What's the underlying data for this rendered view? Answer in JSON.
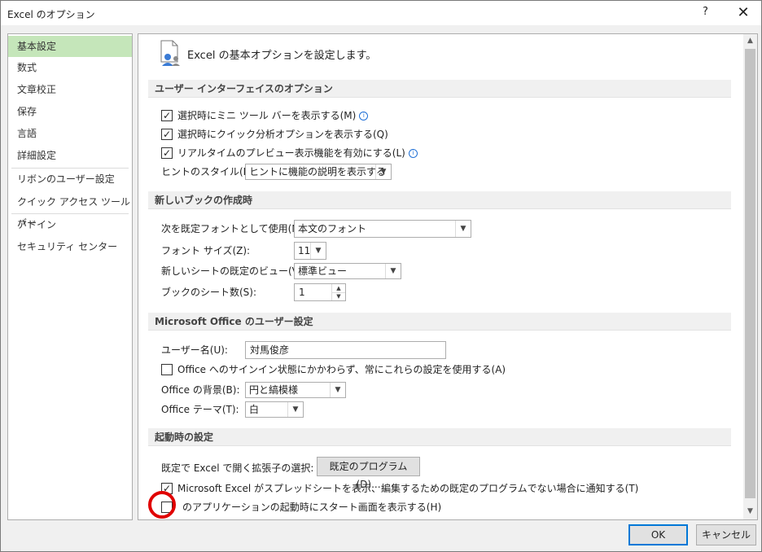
{
  "window": {
    "title": "Excel のオプション",
    "help_label": "?",
    "close_label": "✕"
  },
  "nav": {
    "items": [
      "基本設定",
      "数式",
      "文章校正",
      "保存",
      "言語",
      "詳細設定",
      "リボンのユーザー設定",
      "クイック アクセス ツール バー",
      "アドイン",
      "セキュリティ センター"
    ],
    "selected": "基本設定"
  },
  "header": {
    "text": "Excel の基本オプションを設定します。"
  },
  "ui_options": {
    "title": "ユーザー インターフェイスのオプション",
    "mini_toolbar": {
      "label": "選択時にミニ ツール バーを表示する(M)",
      "checked": true
    },
    "quick_analysis": {
      "label": "選択時にクイック分析オプションを表示する(Q)",
      "checked": true
    },
    "live_preview": {
      "label": "リアルタイムのプレビュー表示機能を有効にする(L)",
      "checked": true
    },
    "screentip_label": "ヒントのスタイル(R):",
    "screentip_value": "ヒントに機能の説明を表示する"
  },
  "new_workbook": {
    "title": "新しいブックの作成時",
    "font_label": "次を既定フォントとして使用(N):",
    "font_value": "本文のフォント",
    "size_label": "フォント サイズ(Z):",
    "size_value": "11",
    "view_label": "新しいシートの既定のビュー(V):",
    "view_value": "標準ビュー",
    "sheets_label": "ブックのシート数(S):",
    "sheets_value": "1"
  },
  "user_settings": {
    "title": "Microsoft Office のユーザー設定",
    "username_label": "ユーザー名(U):",
    "username_value": "対馬俊彦",
    "always_use": {
      "label": "Office へのサインイン状態にかかわらず、常にこれらの設定を使用する(A)",
      "checked": false
    },
    "background_label": "Office の背景(B):",
    "background_value": "円と縞模様",
    "theme_label": "Office テーマ(T):",
    "theme_value": "白"
  },
  "startup": {
    "title": "起動時の設定",
    "extensions_label": "既定で Excel で開く拡張子の選択:",
    "default_programs_button": "既定のプログラム(D)...",
    "notify": {
      "label": "Microsoft Excel がスプレッドシートを表示、編集するための既定のプログラムでない場合に通知する(T)",
      "checked": true
    },
    "start_screen": {
      "label": "のアプリケーションの起動時にスタート画面を表示する(H)",
      "checked": false
    }
  },
  "buttons": {
    "ok": "OK",
    "cancel": "キャンセル"
  },
  "colors": {
    "nav_selected": "#c5e6ba",
    "highlight_circle": "#e00000",
    "ok_border": "#0078d7"
  }
}
